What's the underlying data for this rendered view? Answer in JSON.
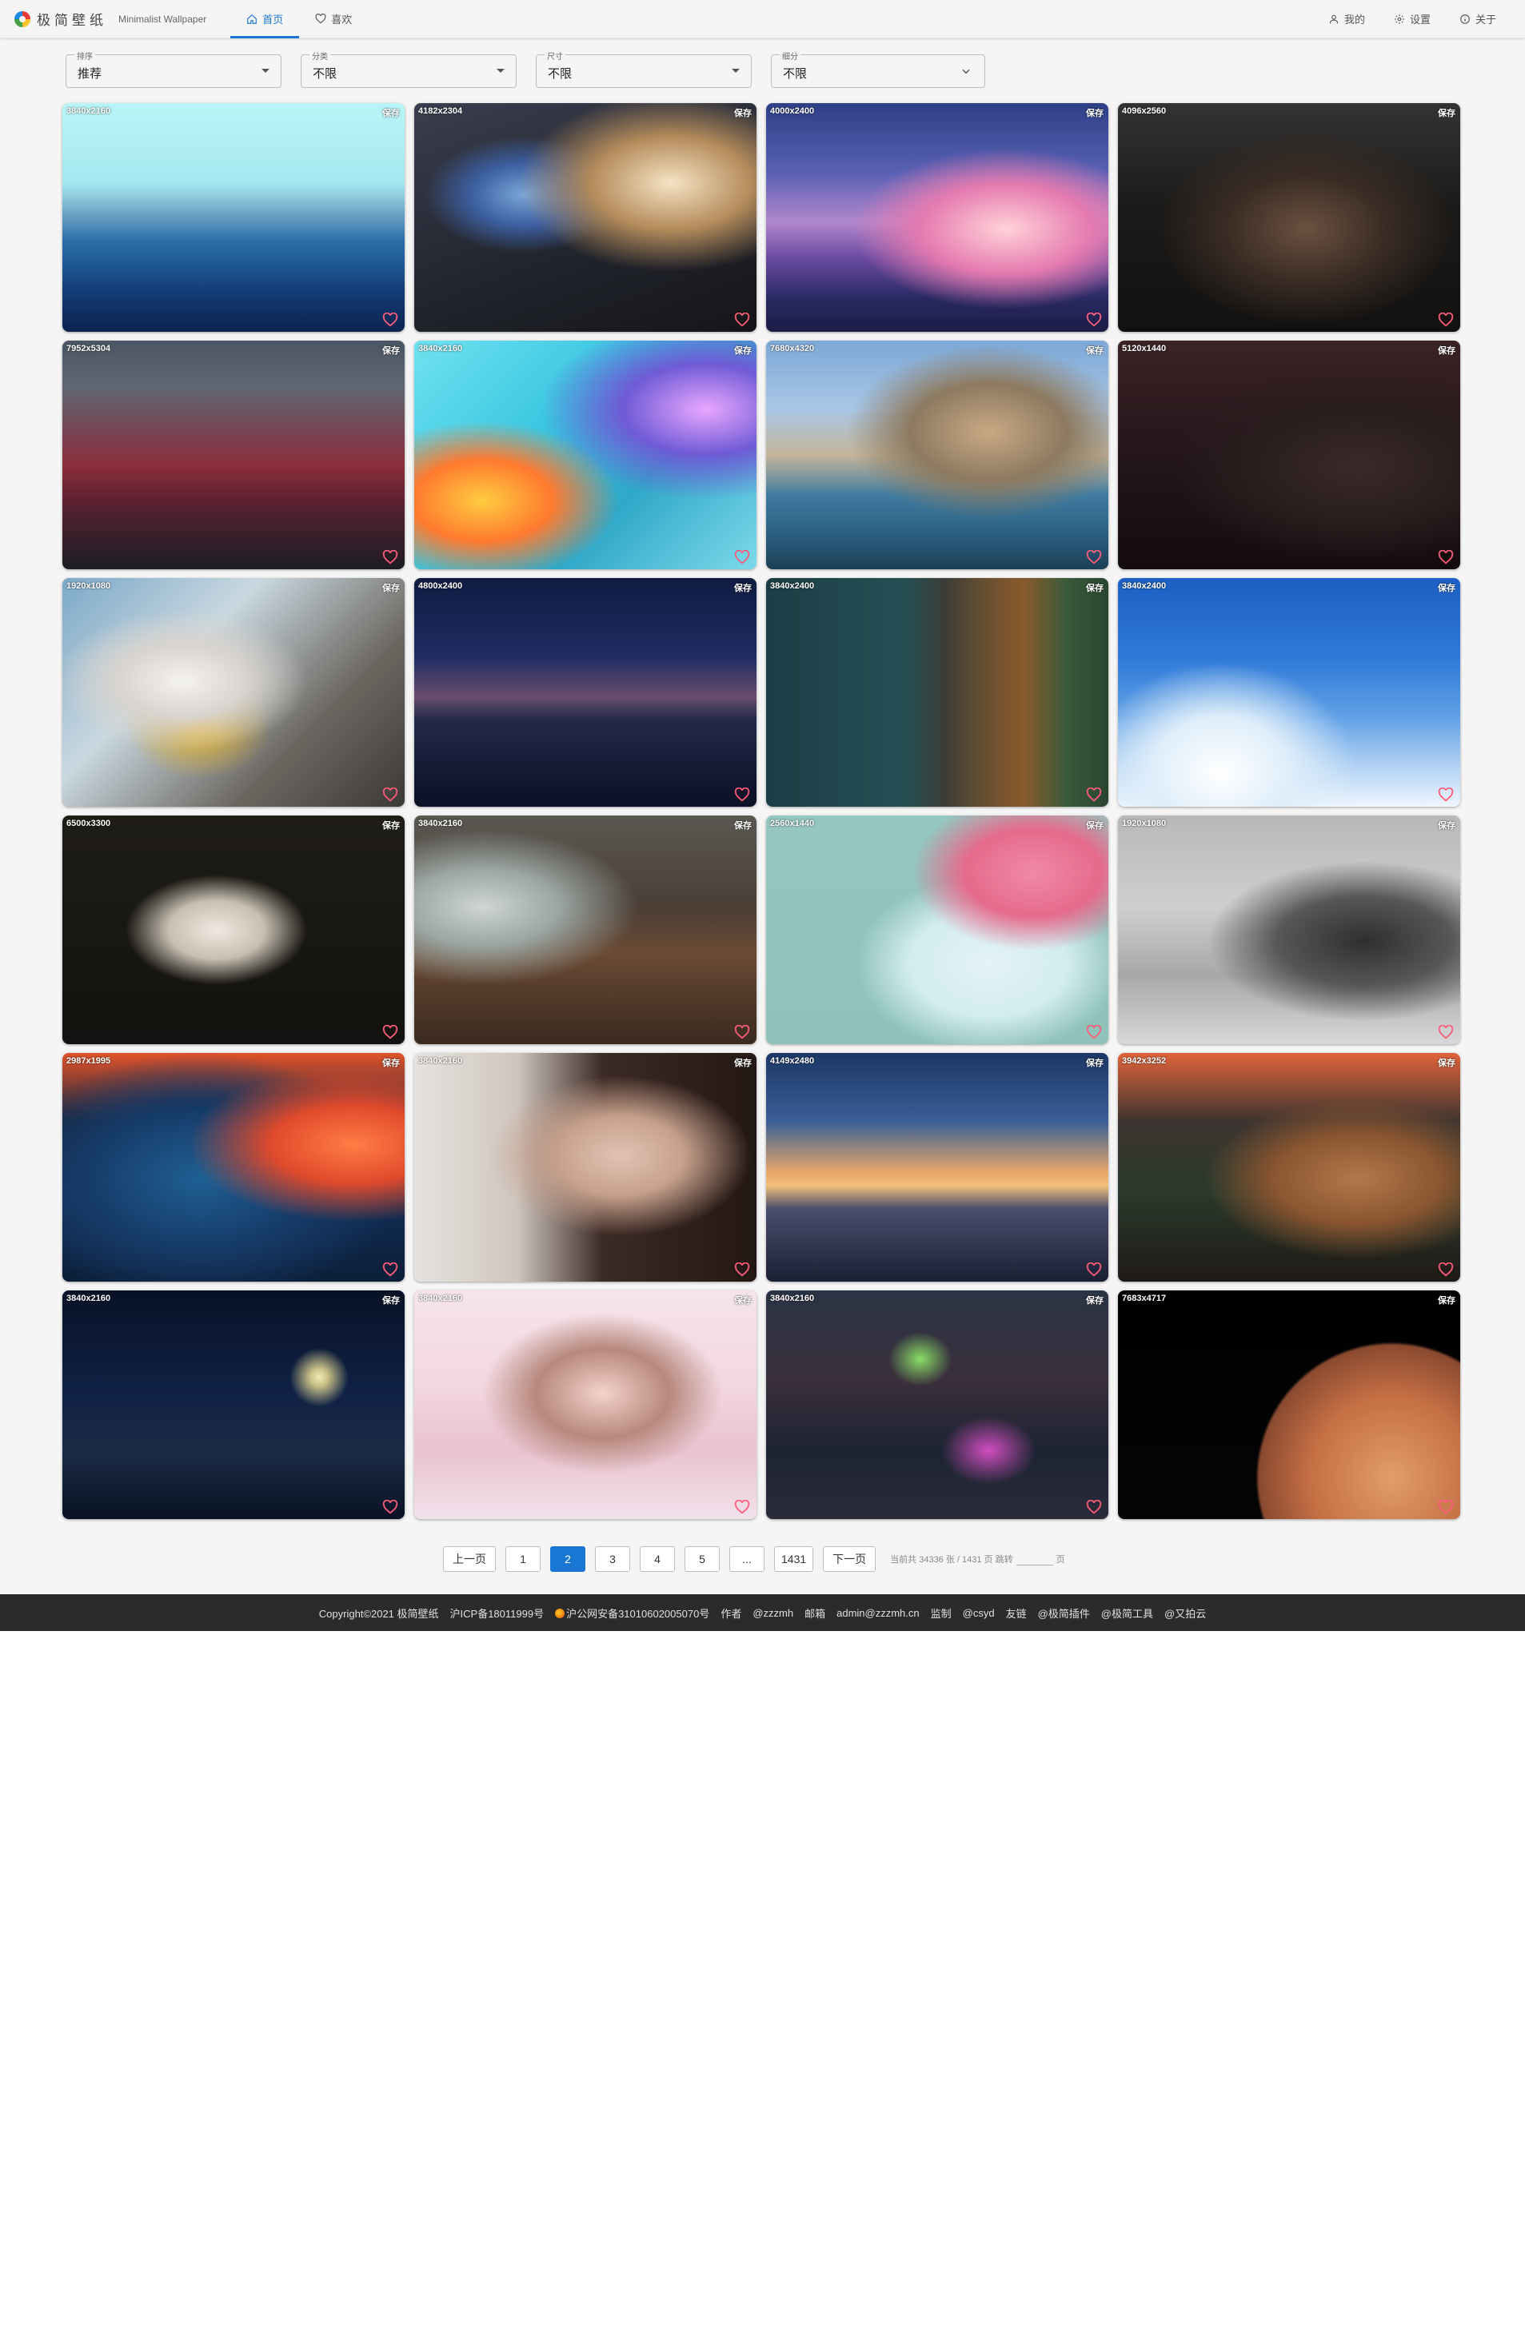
{
  "header": {
    "brand": "极简壁纸",
    "tagline": "Minimalist Wallpaper",
    "tabs": [
      {
        "label": "首页",
        "icon": "home-icon",
        "active": true
      },
      {
        "label": "喜欢",
        "icon": "heart-icon",
        "active": false
      }
    ],
    "right": [
      {
        "label": "我的",
        "icon": "user-icon"
      },
      {
        "label": "设置",
        "icon": "gear-icon"
      },
      {
        "label": "关于",
        "icon": "info-icon"
      }
    ]
  },
  "filters": [
    {
      "label": "排序",
      "value": "推荐"
    },
    {
      "label": "分类",
      "value": "不限"
    },
    {
      "label": "尺寸",
      "value": "不限"
    },
    {
      "label": "细分",
      "value": "不限"
    }
  ],
  "wallpapers": [
    {
      "res": "3840x2160",
      "save": "保存"
    },
    {
      "res": "4182x2304",
      "save": "保存"
    },
    {
      "res": "4000x2400",
      "save": "保存"
    },
    {
      "res": "4096x2560",
      "save": "保存"
    },
    {
      "res": "7952x5304",
      "save": "保存"
    },
    {
      "res": "3840x2160",
      "save": "保存"
    },
    {
      "res": "7680x4320",
      "save": "保存"
    },
    {
      "res": "5120x1440",
      "save": "保存"
    },
    {
      "res": "1920x1080",
      "save": "保存"
    },
    {
      "res": "4800x2400",
      "save": "保存"
    },
    {
      "res": "3840x2400",
      "save": "保存"
    },
    {
      "res": "3840x2400",
      "save": "保存"
    },
    {
      "res": "6500x3300",
      "save": "保存"
    },
    {
      "res": "3840x2160",
      "save": "保存"
    },
    {
      "res": "2560x1440",
      "save": "保存"
    },
    {
      "res": "1920x1080",
      "save": "保存"
    },
    {
      "res": "2987x1995",
      "save": "保存"
    },
    {
      "res": "3840x2160",
      "save": "保存"
    },
    {
      "res": "4149x2480",
      "save": "保存"
    },
    {
      "res": "3942x3252",
      "save": "保存"
    },
    {
      "res": "3840x2160",
      "save": "保存"
    },
    {
      "res": "3840x2160",
      "save": "保存"
    },
    {
      "res": "3840x2160",
      "save": "保存"
    },
    {
      "res": "7683x4717",
      "save": "保存"
    }
  ],
  "pagination": {
    "prev": "上一页",
    "next": "下一页",
    "pages": [
      "1",
      "2",
      "3",
      "4",
      "5",
      "...",
      "1431"
    ],
    "current": "2",
    "info_prefix": "当前共 34336 张 / 1431 页 跳转",
    "info_suffix": "页"
  },
  "footer": {
    "copyright": "Copyright©2021 极简壁纸",
    "icp": "沪ICP备18011999号",
    "police": "沪公网安备31010602005070号",
    "author_label": "作者",
    "author": "@zzzmh",
    "email_label": "邮箱",
    "email": "admin@zzzmh.cn",
    "monitor_label": "监制",
    "monitor": "@csyd",
    "friends_label": "友链",
    "friend1": "@极简插件",
    "friend2": "@极简工具",
    "friend3": "@又拍云"
  }
}
